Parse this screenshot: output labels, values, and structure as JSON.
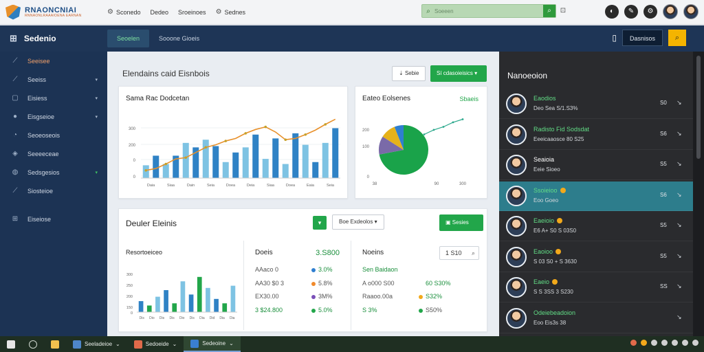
{
  "topbar": {
    "logo_main": "RNAONCNIAI",
    "logo_sub": "RNNAONLRAAAIOENA EARNAN",
    "nav": [
      {
        "icon": "gear-icon",
        "glyph": "⚙",
        "label": "Sconedo"
      },
      {
        "icon": "none",
        "glyph": "",
        "label": "Dedeo"
      },
      {
        "icon": "none",
        "glyph": "",
        "label": "Sroeinoes"
      },
      {
        "icon": "gear-icon",
        "glyph": "⚙",
        "label": "Sednes"
      }
    ],
    "search_placeholder": "Soeeen",
    "icons": [
      "◐",
      "✎",
      "⚙",
      "⊕"
    ]
  },
  "subbar": {
    "brand": "Sedenio",
    "tabs": [
      {
        "label": "Seoelen",
        "active": true
      },
      {
        "label": "Sooone Gioeis",
        "active": false
      }
    ],
    "dark_button": "Dasnisos"
  },
  "sidebar": {
    "items": [
      {
        "icon": "chart-icon",
        "glyph": "⟋",
        "label": "Seeisee",
        "chevron": false,
        "active": true
      },
      {
        "icon": "line-chart-icon",
        "glyph": "⟋",
        "label": "Seeiss",
        "chevron": true,
        "active": false
      },
      {
        "icon": "inbox-icon",
        "glyph": "▢",
        "label": "Eisiess",
        "chevron": true,
        "active": false
      },
      {
        "icon": "user-icon",
        "glyph": "●",
        "label": "Eisgseioe",
        "chevron": true,
        "active": false
      },
      {
        "icon": "clock-icon",
        "glyph": "◔",
        "label": "Seoeoseois",
        "chevron": false,
        "active": false
      },
      {
        "icon": "leaf-icon",
        "glyph": "◈",
        "label": "Seeeeceae",
        "chevron": false,
        "active": false
      },
      {
        "icon": "globe-icon",
        "glyph": "◍",
        "label": "Sedsgesios",
        "chevron": true,
        "chevron_green": true,
        "active": false
      },
      {
        "icon": "trend-icon",
        "glyph": "⟋",
        "label": "Siosteioe",
        "chevron": false,
        "active": false
      }
    ],
    "bottom_item": {
      "icon": "table-icon",
      "glyph": "⊞",
      "label": "Eiseiose"
    }
  },
  "main": {
    "title": "Elendains caid Eisnbois",
    "buttons": {
      "outline": "Sebie",
      "green": "Sí cdasoieisics"
    },
    "chart1": {
      "title": "Sama Rac Dodcetan"
    },
    "chart2": {
      "title": "Eateo Eolsenes",
      "value": "Sbaeis"
    },
    "section2": {
      "title": "Deuler Eleinis",
      "select": "Boe Exdeolos",
      "green_button": "Sesies"
    },
    "card_a": {
      "title": "Resortoeiceo"
    },
    "card_b": {
      "title": "Doeis",
      "total": "3.S800",
      "rows": [
        {
          "k": "AAaco 0",
          "v": "3.0%",
          "color": "#2f7fd0",
          "kg": false,
          "vg": true
        },
        {
          "k": "AA30 $0   3",
          "v": "5.8%",
          "color": "#f08a2c",
          "kg": false,
          "vg": false
        },
        {
          "k": "EX30.00",
          "v": "3M%",
          "color": "#7a4fb8",
          "kg": false,
          "vg": false
        },
        {
          "k": "3   $24.800",
          "v": "5.0%",
          "color": "#22a64a",
          "kg": true,
          "vg": true
        }
      ]
    },
    "card_c": {
      "title": "Noeins",
      "search": "1 S10",
      "rows": [
        {
          "k": "Sen Baidaon",
          "v": "",
          "color": "",
          "kg": true,
          "vg": false
        },
        {
          "k": "A o000 S00",
          "v": "60  S30%",
          "color": "",
          "kg": false,
          "vg": true
        },
        {
          "k": "Raaoo.00a",
          "v": "S32%",
          "color": "#f2a91b",
          "kg": false,
          "vg": true
        },
        {
          "k": "S  3%",
          "v": "S50%",
          "color": "#22a64a",
          "kg": true,
          "vg": false
        }
      ]
    }
  },
  "chart_data": [
    {
      "type": "bar",
      "title": "Sama Rac Dodcetan",
      "ytick_labels": [
        "300",
        "200",
        "0",
        "0"
      ],
      "x_labels": [
        "Daia",
        "Siaa",
        "Dain",
        "Seia",
        "Doea",
        "Deia",
        "Siaa",
        "Doea",
        "Eaia",
        "Seia"
      ],
      "series": [
        {
          "values": [
            20,
            35,
            22,
            35,
            55,
            48,
            60,
            50,
            25,
            40,
            48,
            68,
            30,
            62,
            22,
            70,
            52,
            25,
            55,
            78
          ]
        }
      ],
      "overlay_line": [
        12,
        15,
        22,
        30,
        32,
        40,
        48,
        52,
        58,
        62,
        70,
        76,
        80,
        72,
        60,
        62,
        68,
        75,
        84,
        92
      ]
    },
    {
      "type": "pie",
      "title": "Eateo Eolsenes",
      "slices": [
        {
          "value": 72,
          "color": "#1aa34a"
        },
        {
          "value": 12,
          "color": "#7a6aa8"
        },
        {
          "value": 10,
          "color": "#e6b21a"
        },
        {
          "value": 6,
          "color": "#2f7fd0"
        }
      ],
      "ytick_labels": [
        "200",
        "100",
        "0"
      ],
      "x_labels": [
        "38",
        "90",
        "300"
      ],
      "trend": [
        30,
        42,
        50,
        62,
        70
      ]
    },
    {
      "type": "bar",
      "title": "Resortoeiceo",
      "ytick_labels": [
        "300",
        "250",
        "200",
        "150",
        "0"
      ],
      "x_labels": [
        "Dis",
        "Dio",
        "Dis",
        "Dis",
        "Dio",
        "Dis",
        "Dia",
        "Did",
        "Dia",
        "Dia"
      ],
      "values": [
        25,
        15,
        35,
        50,
        20,
        70,
        40,
        80,
        55,
        30,
        20,
        60
      ]
    }
  ],
  "rpanel": {
    "title": "Nanoeoion",
    "people": [
      {
        "name": "Eaodios",
        "sub": "Deo Sea S/1.S3%",
        "time": "S0",
        "name_green": true,
        "badge": false,
        "sel": false
      },
      {
        "name": "Radisto Fid Sodsdat",
        "sub": "Eeeicaaosce 80 S25",
        "time": "S6",
        "name_green": true,
        "badge": false,
        "sel": false
      },
      {
        "name": "Seaioia",
        "sub": "Eeie Sioeo",
        "time": "S5",
        "name_green": false,
        "badge": false,
        "sel": false
      },
      {
        "name": "Ssoieioo",
        "sub": "Eoo Goeo",
        "time": "S6",
        "name_green": true,
        "badge": true,
        "sel": true
      },
      {
        "name": "Eaeioio",
        "sub": "E6 A+ S0 S 03S0",
        "time": "S5",
        "name_green": true,
        "badge": true,
        "sel": false
      },
      {
        "name": "Eaoioo",
        "sub": "S  03 S0 + S 3630",
        "time": "S5",
        "name_green": true,
        "badge": true,
        "sel": false
      },
      {
        "name": "Eaeio",
        "sub": "S  S 3SS 3 S230",
        "time": "SS",
        "name_green": true,
        "badge": true,
        "sel": false
      },
      {
        "name": "Odeiebeadoion",
        "sub": "Eoo Eis3s 38",
        "time": "",
        "name_green": true,
        "badge": false,
        "sel": false
      }
    ]
  },
  "taskbar": {
    "items": [
      {
        "label": "",
        "icon": "windows-icon",
        "color": "#e6e6e6"
      },
      {
        "label": "",
        "icon": "search-icon",
        "color": "#4a5a4c"
      },
      {
        "label": "",
        "icon": "folder-icon",
        "color": "#f2c14e"
      },
      {
        "label": "Seeladeioe",
        "icon": "app-icon",
        "color": "#4e86c8",
        "active": false
      },
      {
        "label": "Sedoeide",
        "icon": "app-icon",
        "color": "#e06a4a",
        "active": false
      },
      {
        "label": "Sedeoine",
        "icon": "app-icon",
        "color": "#3a7fd0",
        "active": true
      }
    ]
  }
}
